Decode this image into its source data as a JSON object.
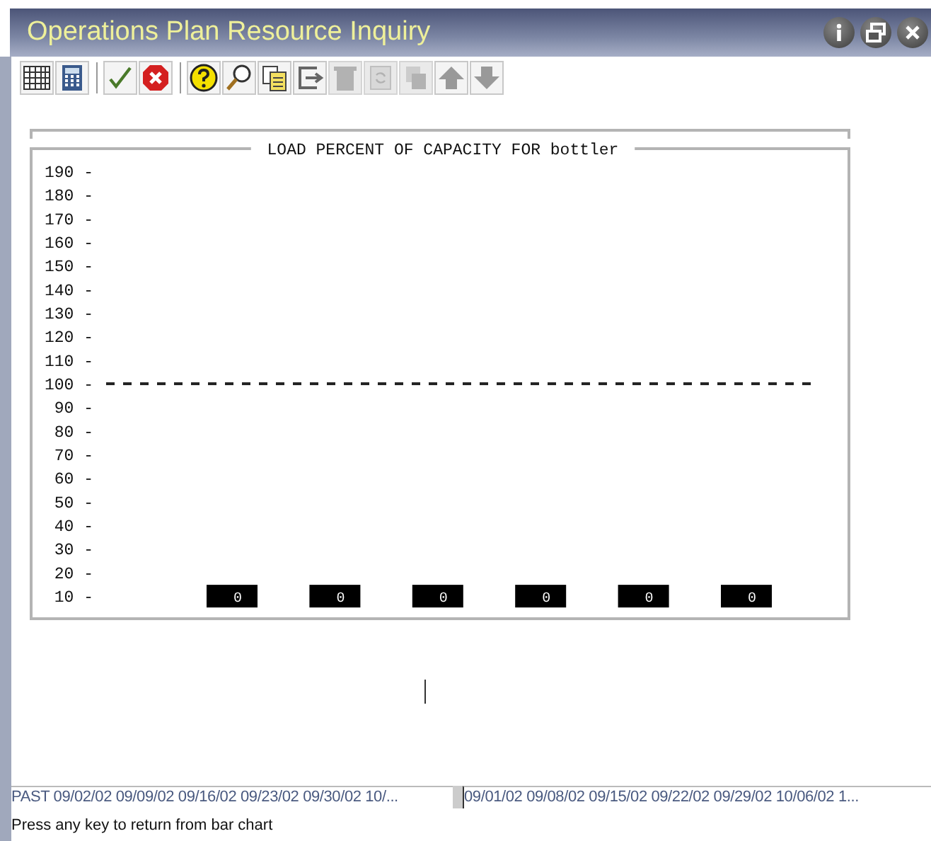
{
  "window": {
    "title": "Operations Plan Resource Inquiry"
  },
  "title_buttons": [
    {
      "kind": "info"
    },
    {
      "kind": "restore"
    },
    {
      "kind": "close"
    }
  ],
  "toolbar": [
    [
      {
        "kind": "calendar",
        "disabled": false
      },
      {
        "kind": "calculator",
        "disabled": false
      }
    ],
    [
      {
        "kind": "check",
        "disabled": false
      },
      {
        "kind": "stop",
        "disabled": false
      }
    ],
    [
      {
        "kind": "help",
        "disabled": false
      },
      {
        "kind": "search",
        "disabled": false
      },
      {
        "kind": "copy",
        "disabled": false
      },
      {
        "kind": "exit",
        "disabled": false
      },
      {
        "kind": "trash",
        "disabled": true
      },
      {
        "kind": "refresh",
        "disabled": true
      },
      {
        "kind": "pages",
        "disabled": true
      },
      {
        "kind": "up",
        "disabled": false
      },
      {
        "kind": "down",
        "disabled": false
      }
    ]
  ],
  "chart": {
    "title": "LOAD PERCENT OF CAPACITY FOR bottler",
    "rows": [
      {
        "label": "190 -",
        "dashed": false
      },
      {
        "label": "180 -",
        "dashed": false
      },
      {
        "label": "170 -",
        "dashed": false
      },
      {
        "label": "160 -",
        "dashed": false
      },
      {
        "label": "150 -",
        "dashed": false
      },
      {
        "label": "140 -",
        "dashed": false
      },
      {
        "label": "130 -",
        "dashed": false
      },
      {
        "label": "120 -",
        "dashed": false
      },
      {
        "label": "110 -",
        "dashed": false
      },
      {
        "label": "100 -",
        "dashed": true
      },
      {
        "label": "90 -",
        "dashed": false
      },
      {
        "label": "80 -",
        "dashed": false
      },
      {
        "label": "70 -",
        "dashed": false
      },
      {
        "label": "60 -",
        "dashed": false
      },
      {
        "label": "50 -",
        "dashed": false
      },
      {
        "label": "40 -",
        "dashed": false
      },
      {
        "label": "30 -",
        "dashed": false
      },
      {
        "label": "20 -",
        "dashed": false
      },
      {
        "label": "10 -",
        "dashed": false,
        "cells": [
          "0",
          "0",
          "0",
          "0",
          "0",
          "0"
        ]
      }
    ]
  },
  "date_strip": {
    "left": "PAST 09/02/02 09/09/02 09/16/02 09/23/02 09/30/02 10/...",
    "right": "09/01/02 09/08/02 09/15/02 09/22/02 09/29/02 10/06/02 1..."
  },
  "status_bar": "Press any key to return from bar chart"
}
